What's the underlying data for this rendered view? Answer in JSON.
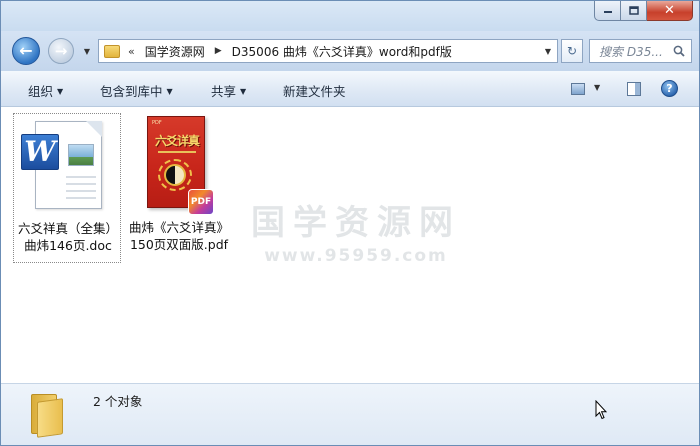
{
  "window": {
    "caption_buttons": {
      "minimize": "minimize",
      "maximize": "maximize",
      "close": "✕"
    }
  },
  "navigation": {
    "back_icon": "arrow-left-icon",
    "forward_icon": "arrow-right-icon"
  },
  "address_bar": {
    "overflow_chevron": "«",
    "segments": [
      "国学资源网",
      "D35006 曲炜《六爻详真》word和pdf版"
    ]
  },
  "search": {
    "placeholder": "搜索 D35..."
  },
  "command_bar": {
    "organize": "组织",
    "include_in_library": "包含到库中",
    "share": "共享",
    "new_folder": "新建文件夹"
  },
  "files": [
    {
      "name_line1": "六爻祥真（全集）",
      "name_line2": "曲炜146页.doc",
      "type": "word-document"
    },
    {
      "name_line1": "曲炜《六爻详真》",
      "name_line2": "150页双面版.pdf",
      "type": "pdf-document"
    }
  ],
  "pdf_cover": {
    "title": "六爻详真",
    "badge": "PDF"
  },
  "watermark": {
    "text": "国学资源网",
    "url": "www.95959.com"
  },
  "details": {
    "count": "2 个对象"
  },
  "colors": {
    "close_button": "#c7402b",
    "accent": "#2f74c3"
  }
}
